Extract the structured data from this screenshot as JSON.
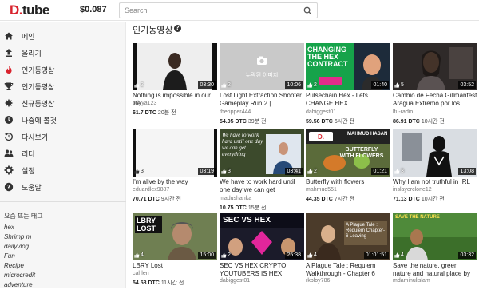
{
  "header": {
    "logo_text": "tube",
    "logo_prefix": "D.",
    "balance": "$0.087",
    "search_placeholder": "Search"
  },
  "sidebar": {
    "items": [
      {
        "label": "메인",
        "icon": "home-icon"
      },
      {
        "label": "올리기",
        "icon": "upload-icon"
      },
      {
        "label": "인기동영상",
        "icon": "fire-icon"
      },
      {
        "label": "인기동영상",
        "icon": "trophy-icon"
      },
      {
        "label": "신규동영상",
        "icon": "new-icon"
      },
      {
        "label": "나중에 볼것",
        "icon": "clock-icon"
      },
      {
        "label": "다시보기",
        "icon": "history-icon"
      },
      {
        "label": "리더",
        "icon": "leader-icon"
      },
      {
        "label": "설정",
        "icon": "gear-icon"
      },
      {
        "label": "도움말",
        "icon": "help-icon"
      }
    ],
    "tags_heading": "요즘 뜨는 태그",
    "tags": [
      "hex",
      "Shrimp m",
      "dailyvlog",
      "Fun",
      "Recipe",
      "microcredit",
      "adventure"
    ]
  },
  "main": {
    "section_title": "인기동영상",
    "videos": [
      {
        "title": "Nothing is impossible in our life.",
        "author": "priyya123",
        "value": "61.7 DTC",
        "age": "20분 전",
        "duration": "03:30",
        "votes": "2",
        "thumb_color": "#f0f0f0"
      },
      {
        "title": "Lost Light Extraction Shooter Gameplay Run 2 |",
        "author": "theripper444",
        "value": "54.05 DTC",
        "age": "39분 전",
        "duration": "10:06",
        "votes": "2",
        "thumb_color": "#c8c8c8",
        "placeholder": "누락된 이미지"
      },
      {
        "title": "Pulsechain Hex - Lets CHANGE HEX...",
        "author": "dabiggest01",
        "value": "59.56 DTC",
        "age": "6시간 전",
        "duration": "01:40",
        "votes": "2",
        "thumb_color": "#1a8c3a",
        "overlay": "CHANGING THE HEX CONTRACT"
      },
      {
        "title": "Cambio de Fecha Gillmanfest Aragua Extremo por los estrago...",
        "author": "lfu-radio",
        "value": "86.91 DTC",
        "age": "10시간 전",
        "duration": "03:52",
        "votes": "5",
        "thumb_color": "#2e2a2a"
      },
      {
        "title": "I'm alive by the way",
        "author": "eduardlex9887",
        "value": "70.71 DTC",
        "age": "9시간 전",
        "duration": "03:19",
        "votes": "3",
        "thumb_color": "#f4f4f4"
      },
      {
        "title": "We have to work hard until one day we can get everything we...",
        "author": "madushanka",
        "value": "10.75 DTC",
        "age": "15분 전",
        "duration": "03:41",
        "votes": "3",
        "thumb_color": "#3b4a2d",
        "overlay": "We have to work hard until one day we can get everything"
      },
      {
        "title": "Butterfly with flowers",
        "author": "mahmud551",
        "value": "44.35 DTC",
        "age": "7시간 전",
        "duration": "01:21",
        "votes": "2",
        "thumb_color": "#2a2a2a",
        "overlay": "BUTTERFLY WITH FLOWERS",
        "overlay_top": "MAHMUD HASAN"
      },
      {
        "title": "Why I am not truthful in IRL",
        "author": "inslayerclone12",
        "value": "71.13 DTC",
        "age": "10시간 전",
        "duration": "13:08",
        "votes": "3",
        "thumb_color": "#d9dde2"
      },
      {
        "title": "LBRY Lost",
        "author": "cahlen",
        "value": "54.58 DTC",
        "age": "11시간 전",
        "duration": "15:00",
        "votes": "4",
        "thumb_color": "#6b7a4f",
        "overlay": "LBRY LOST"
      },
      {
        "title": "SEC VS HEX CRYPTO YOUTUBERS IS HEX RICHARD...",
        "author": "dabiggest01",
        "value": "",
        "age": "",
        "duration": "25:38",
        "votes": "2",
        "thumb_color": "#c0392b",
        "overlay": "SEC VS HEX"
      },
      {
        "title": "A Plague Tale : Requiem Walkthrough - Chapter 6 Leavin...",
        "author": "rkploy786",
        "value": "",
        "age": "",
        "duration": "01:01:51",
        "votes": "4",
        "thumb_color": "#4a3a2a",
        "overlay": "A Plague Tale : Requiem Chapter-6 Leaving"
      },
      {
        "title": "Save the nature, green nature and natural place by removing...",
        "author": "mdaminulislam",
        "value": "",
        "age": "",
        "duration": "03:32",
        "votes": "4",
        "thumb_color": "#4f8a3a",
        "overlay": "SAVE THE NATURE"
      }
    ]
  },
  "colors": {
    "brand": "#d9232d",
    "sidebar_bg": "#f6f6f6"
  }
}
